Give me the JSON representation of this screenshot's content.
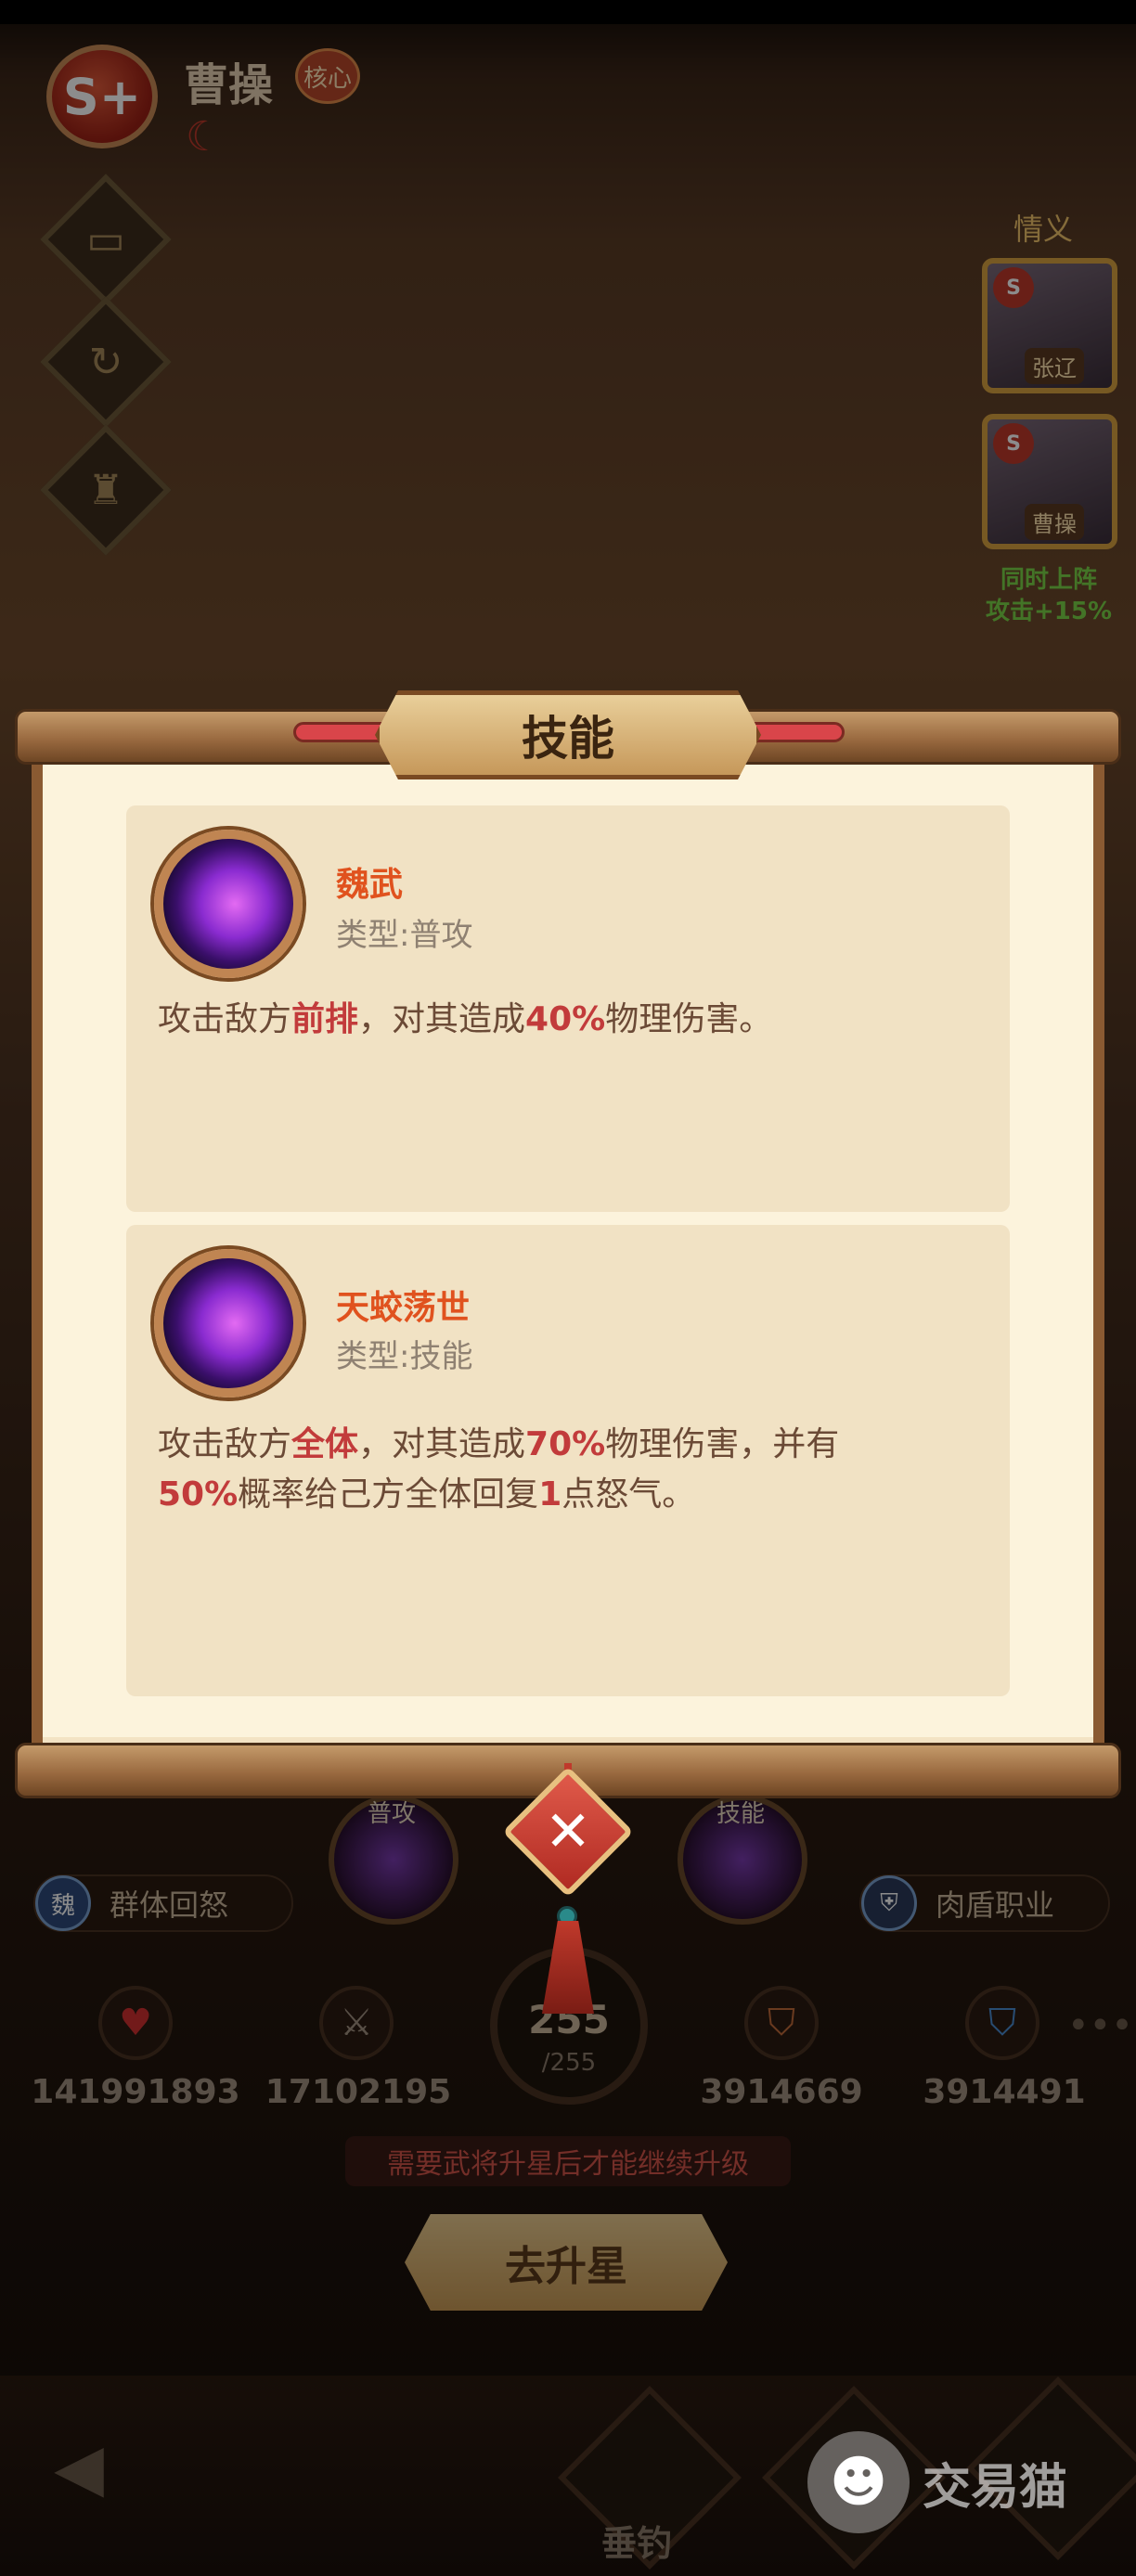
{
  "header": {
    "rank_badge": "S+",
    "hero_name": "曹操",
    "core_tag": "核心"
  },
  "side_panel": {
    "label": "情义",
    "portraits": [
      {
        "rank": "S",
        "name": "张辽"
      },
      {
        "rank": "S",
        "name": "曹操"
      }
    ],
    "bonus_line1": "同时上阵",
    "bonus_line2": "攻击+15%"
  },
  "modal": {
    "title": "技能",
    "skills": [
      {
        "name": "魏武",
        "type": "类型:普攻",
        "desc_parts": [
          "攻击敌方",
          "前排",
          "，对其造成",
          "40%",
          "物理伤害。"
        ]
      },
      {
        "name": "天蛟荡世",
        "type": "类型:技能",
        "desc_line1_parts": [
          "攻击敌方",
          "全体",
          "，对其造成",
          "70%",
          "物理伤害，并有"
        ],
        "desc_line2_parts": [
          "50%",
          "概率给己方全体回复",
          "1",
          "点怒气。"
        ]
      }
    ]
  },
  "background_ui": {
    "slot_left_label": "普攻",
    "slot_right_label": "技能",
    "trait_left": {
      "icon_text": "魏",
      "label": "群体回怒"
    },
    "trait_right": {
      "label": "肉盾职业"
    },
    "stats": [
      {
        "icon": "heart-icon",
        "value": "141991893"
      },
      {
        "icon": "swords-icon",
        "value": "17102195"
      },
      {
        "icon": "shield-icon",
        "value": "3914669"
      },
      {
        "icon": "magic-shield-icon",
        "value": "3914491"
      }
    ],
    "level_current": "255",
    "level_max": "/255",
    "notice": "需要武将升星后才能继续升级",
    "upgrade_button": "去升星",
    "nav_label": "垂钓"
  },
  "watermark": {
    "text": "交易猫"
  },
  "colors": {
    "highlight": "#c23b3b",
    "skill_name": "#e0521e",
    "paper": "#fcf3dc"
  }
}
